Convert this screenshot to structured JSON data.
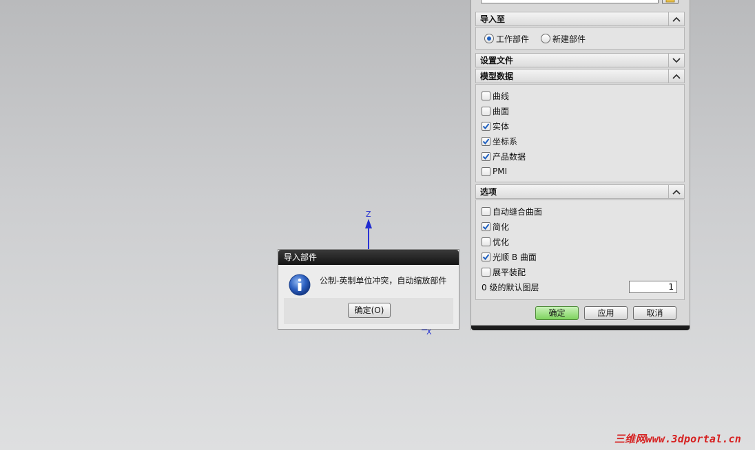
{
  "viewport": {
    "z_label": "Z",
    "x_label": "X"
  },
  "panel": {
    "import_to": {
      "title": "导入至",
      "options": [
        {
          "label": "工作部件",
          "selected": true
        },
        {
          "label": "新建部件",
          "selected": false
        }
      ]
    },
    "settings_file": {
      "title": "设置文件",
      "expanded": false
    },
    "model_data": {
      "title": "模型数据",
      "items": [
        {
          "label": "曲线",
          "checked": false
        },
        {
          "label": "曲面",
          "checked": false
        },
        {
          "label": "实体",
          "checked": true
        },
        {
          "label": "坐标系",
          "checked": true
        },
        {
          "label": "产品数据",
          "checked": true
        },
        {
          "label": "PMI",
          "checked": false
        }
      ]
    },
    "options": {
      "title": "选项",
      "items": [
        {
          "label": "自动缝合曲面",
          "checked": false
        },
        {
          "label": "简化",
          "checked": true
        },
        {
          "label": "优化",
          "checked": false
        },
        {
          "label": "光顺 B 曲面",
          "checked": true
        },
        {
          "label": "展平装配",
          "checked": false
        }
      ],
      "default_layer_label": "0 级的默认图层",
      "default_layer_value": "1"
    },
    "buttons": {
      "ok": "确定",
      "apply": "应用",
      "cancel": "取消"
    }
  },
  "dialog": {
    "title": "导入部件",
    "message": "公制-英制单位冲突，自动缩放部件",
    "ok_label": "确定(O)"
  },
  "watermark": "三维网www.3dportal.cn",
  "colors": {
    "accent_blue": "#1f2bd0",
    "check_blue": "#1d5fc0",
    "primary_green": "#7fd35f",
    "watermark_red": "#d62020"
  }
}
